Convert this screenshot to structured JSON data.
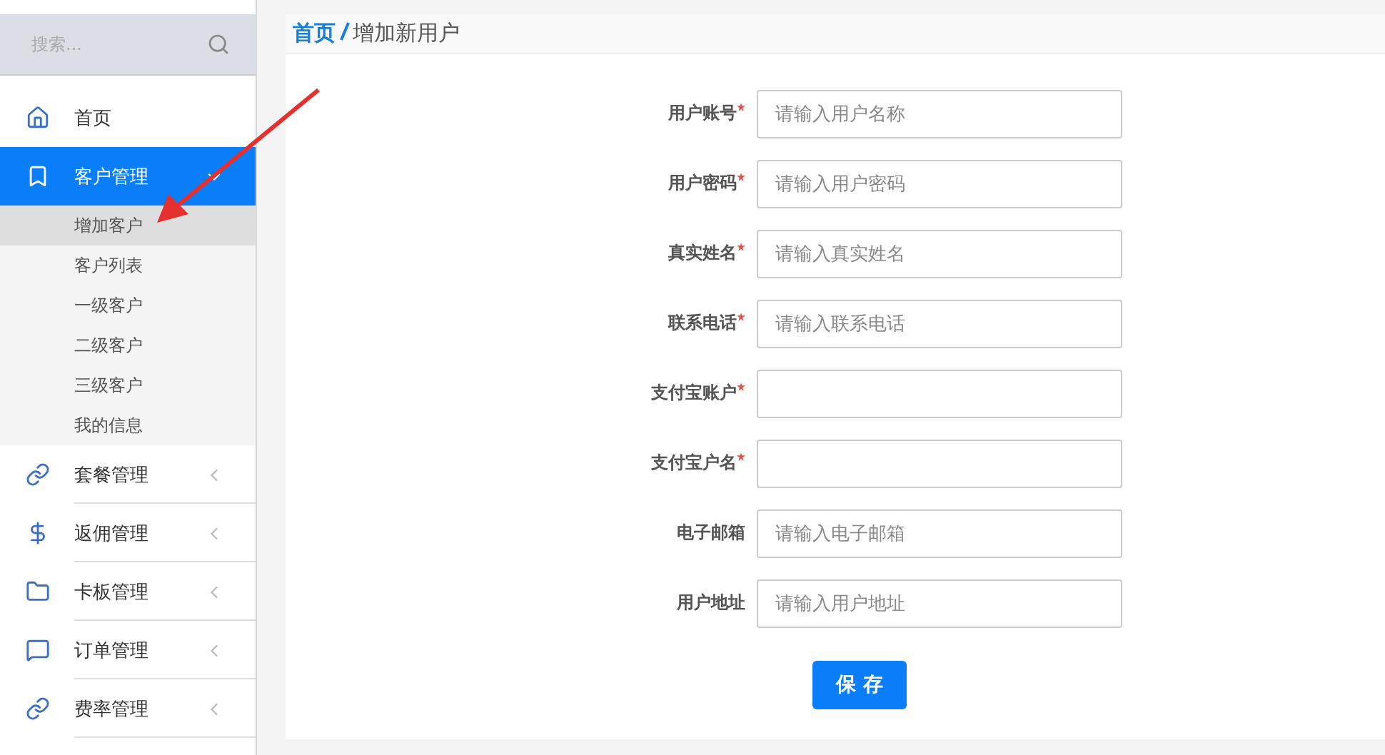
{
  "sidebar": {
    "search": {
      "placeholder": "搜索..."
    },
    "items": [
      {
        "label": "首页",
        "selected": false
      },
      {
        "label": "客户管理",
        "selected": true,
        "expanded": true,
        "children": [
          {
            "label": "增加客户",
            "selected": true
          },
          {
            "label": "客户列表",
            "selected": false
          },
          {
            "label": "一级客户",
            "selected": false
          },
          {
            "label": "二级客户",
            "selected": false
          },
          {
            "label": "三级客户",
            "selected": false
          },
          {
            "label": "我的信息",
            "selected": false
          }
        ]
      },
      {
        "label": "套餐管理",
        "selected": false,
        "expanded": false
      },
      {
        "label": "返佣管理",
        "selected": false,
        "expanded": false
      },
      {
        "label": "卡板管理",
        "selected": false,
        "expanded": false
      },
      {
        "label": "订单管理",
        "selected": false,
        "expanded": false
      },
      {
        "label": "费率管理",
        "selected": false,
        "expanded": false
      }
    ]
  },
  "breadcrumb": {
    "home": "首页",
    "current": "增加新用户"
  },
  "form": {
    "fields": [
      {
        "label": "用户账号",
        "required": true,
        "placeholder": "请输入用户名称"
      },
      {
        "label": "用户密码",
        "required": true,
        "placeholder": "请输入用户密码"
      },
      {
        "label": "真实姓名",
        "required": true,
        "placeholder": "请输入真实姓名"
      },
      {
        "label": "联系电话",
        "required": true,
        "placeholder": "请输入联系电话"
      },
      {
        "label": "支付宝账户",
        "required": true
      },
      {
        "label": "支付宝户名",
        "required": true
      },
      {
        "label": "电子邮箱",
        "required": false,
        "placeholder": "请输入电子邮箱"
      },
      {
        "label": "用户地址",
        "required": false,
        "placeholder": "请输入用户地址"
      }
    ],
    "submit": "保 存"
  }
}
